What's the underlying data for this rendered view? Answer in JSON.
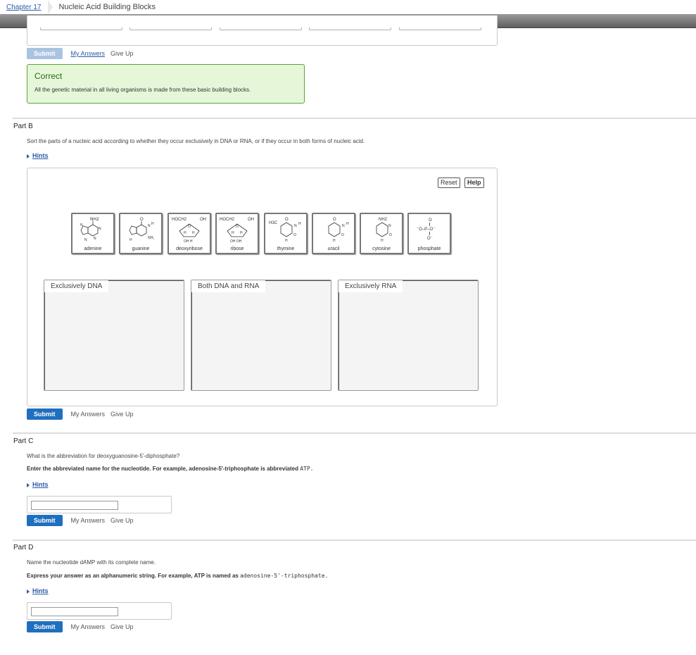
{
  "breadcrumb": {
    "chapter": "Chapter 17",
    "current": "Nucleic Acid Building Blocks"
  },
  "partA": {
    "submit_label": "Submit",
    "my_answers_label": "My Answers",
    "give_up_label": "Give Up",
    "feedback": {
      "title": "Correct",
      "message": "All the genetic material in all living organisms is made from these basic building blocks."
    }
  },
  "partB": {
    "title": "Part B",
    "prompt": "Sort the parts of a nucleic acid according to whether they occur exclusively in DNA or RNA, or if they occur in both forms of nucleic acid.",
    "hints_label": "Hints",
    "reset_label": "Reset",
    "help_label": "Help",
    "tiles": [
      {
        "label": "adenine",
        "icon": "adenine-structure-icon",
        "formula": "NH2"
      },
      {
        "label": "guanine",
        "icon": "guanine-structure-icon",
        "formula": "O"
      },
      {
        "label": "deoxyribose",
        "icon": "deoxyribose-structure-icon",
        "formula": "HOCH2"
      },
      {
        "label": "ribose",
        "icon": "ribose-structure-icon",
        "formula": "HOCH2"
      },
      {
        "label": "thymine",
        "icon": "thymine-structure-icon",
        "formula": "H3C"
      },
      {
        "label": "uracil",
        "icon": "uracil-structure-icon",
        "formula": "O"
      },
      {
        "label": "cytosine",
        "icon": "cytosine-structure-icon",
        "formula": "NH2"
      },
      {
        "label": "phosphate",
        "icon": "phosphate-structure-icon",
        "formula": "O"
      }
    ],
    "bins": [
      {
        "label": "Exclusively DNA"
      },
      {
        "label": "Both DNA and RNA"
      },
      {
        "label": "Exclusively RNA"
      }
    ],
    "submit_label": "Submit",
    "my_answers_label": "My Answers",
    "give_up_label": "Give Up"
  },
  "partC": {
    "title": "Part C",
    "prompt": "What is the abbreviation for deoxyguanosine-5'-diphosphate?",
    "instruction": "Enter the abbreviated name for the nucleotide. For example, adenosine-5'-triphosphate is abbreviated",
    "instruction_code": "ATP.",
    "hints_label": "Hints",
    "answer_value": "",
    "submit_label": "Submit",
    "my_answers_label": "My Answers",
    "give_up_label": "Give Up"
  },
  "partD": {
    "title": "Part D",
    "prompt": "Name the nucleotide dAMP with its complete name.",
    "instruction": "Express your answer as an alphanumeric string. For example, ATP is named as",
    "instruction_code": "adenosine-5'-triphosphate.",
    "hints_label": "Hints",
    "answer_value": "",
    "submit_label": "Submit",
    "my_answers_label": "My Answers",
    "give_up_label": "Give Up"
  },
  "colors": {
    "accent": "#1f6fbf",
    "correct_bg": "#e6f7d9",
    "correct_border": "#5aa338",
    "link": "#2b5aa8"
  }
}
